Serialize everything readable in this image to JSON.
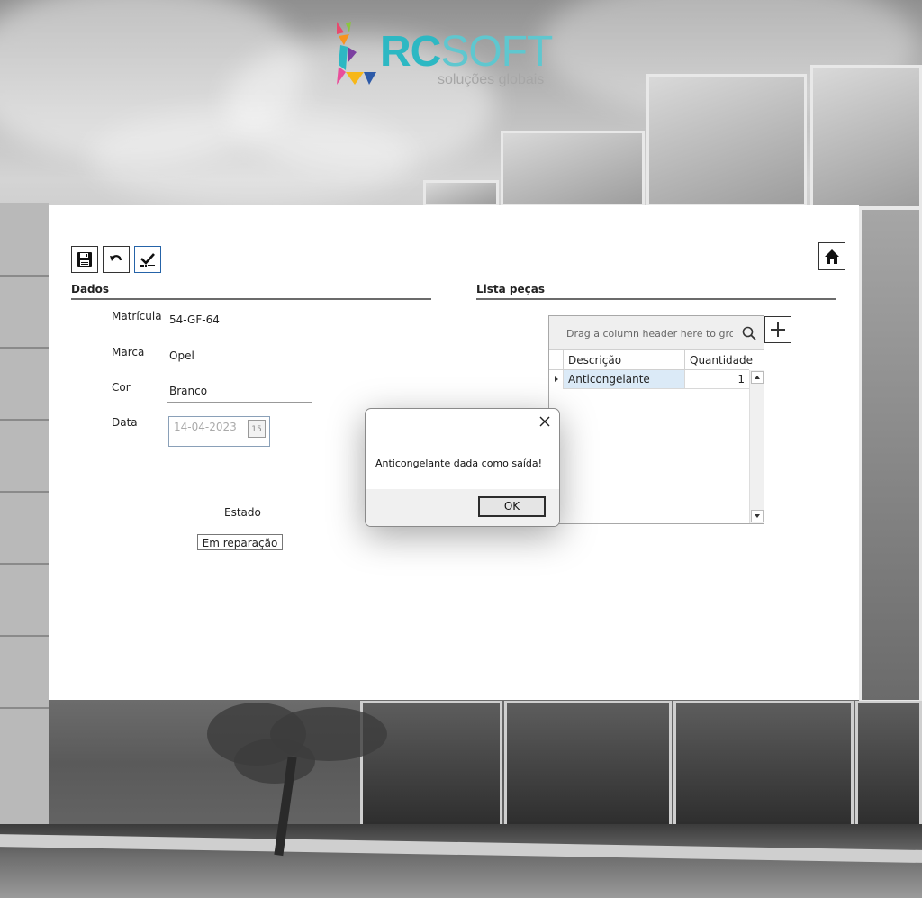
{
  "brand": {
    "name_part1": "RC",
    "name_part2": "SOFT",
    "tagline": "soluções globais",
    "colors": {
      "primary": "#2db8c3"
    }
  },
  "toolbar": {
    "save_icon": "floppy-disk-icon",
    "undo_icon": "undo-icon",
    "confirm_icon": "checkmark-icon",
    "home_icon": "home-icon"
  },
  "dados": {
    "title": "Dados",
    "fields": {
      "matricula": {
        "label": "Matrícula",
        "value": "54-GF-64"
      },
      "marca": {
        "label": "Marca",
        "value": "Opel"
      },
      "cor": {
        "label": "Cor",
        "value": "Branco"
      },
      "data": {
        "label": "Data",
        "value": "14-04-2023",
        "calendar_day": "15"
      }
    },
    "estado": {
      "label": "Estado",
      "value": "Em reparação"
    }
  },
  "pecas": {
    "title": "Lista peças",
    "group_hint": "Drag a column header here to grou...",
    "columns": [
      "Descrição",
      "Quantidade"
    ],
    "rows": [
      {
        "descricao": "Anticongelante",
        "quantidade": "1"
      }
    ],
    "add_icon": "plus-icon"
  },
  "dialog": {
    "message": "Anticongelante dada como saída!",
    "ok_label": "OK"
  }
}
